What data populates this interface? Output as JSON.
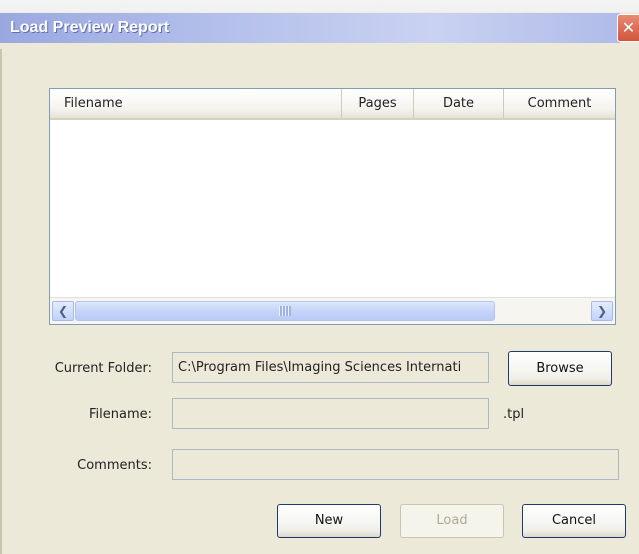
{
  "window": {
    "title": "Load Preview Report",
    "close_glyph": "✕"
  },
  "file_list": {
    "columns": [
      "Filename",
      "Pages",
      "Date",
      "Comment"
    ],
    "rows": []
  },
  "scrollbar": {
    "left_arrow": "❮",
    "right_arrow": "❯"
  },
  "form": {
    "current_folder_label": "Current Folder:",
    "current_folder_value": "C:\\Program Files\\Imaging Sciences Internati",
    "filename_label": "Filename:",
    "filename_value": "",
    "extension": ".tpl",
    "comments_label": "Comments:",
    "comments_value": ""
  },
  "buttons": {
    "browse": "Browse",
    "new": "New",
    "load": "Load",
    "cancel": "Cancel"
  },
  "colors": {
    "title_bar": "#b7c2ec",
    "close_button": "#d2553b",
    "dialog_background": "#ece9d8",
    "button_border": "#1e3a73"
  }
}
